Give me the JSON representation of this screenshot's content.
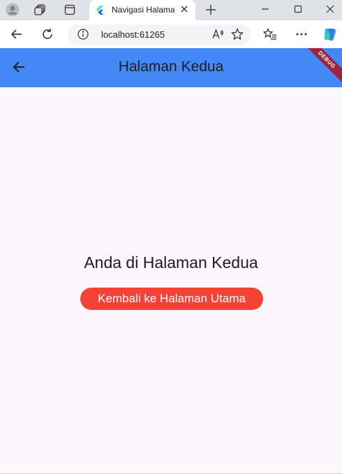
{
  "browser": {
    "tab": {
      "title": "Navigasi Halaman"
    },
    "address_bar": {
      "url": "localhost:61265"
    }
  },
  "app": {
    "appbar_title": "Halaman Kedua",
    "debug_banner": "DEBUG",
    "heading": "Anda di Halaman Kedua",
    "button_label": "Kembali ke Halaman Utama"
  },
  "colors": {
    "appbar": "#4488f8",
    "button": "#f44336",
    "background": "#fdf7fd"
  }
}
